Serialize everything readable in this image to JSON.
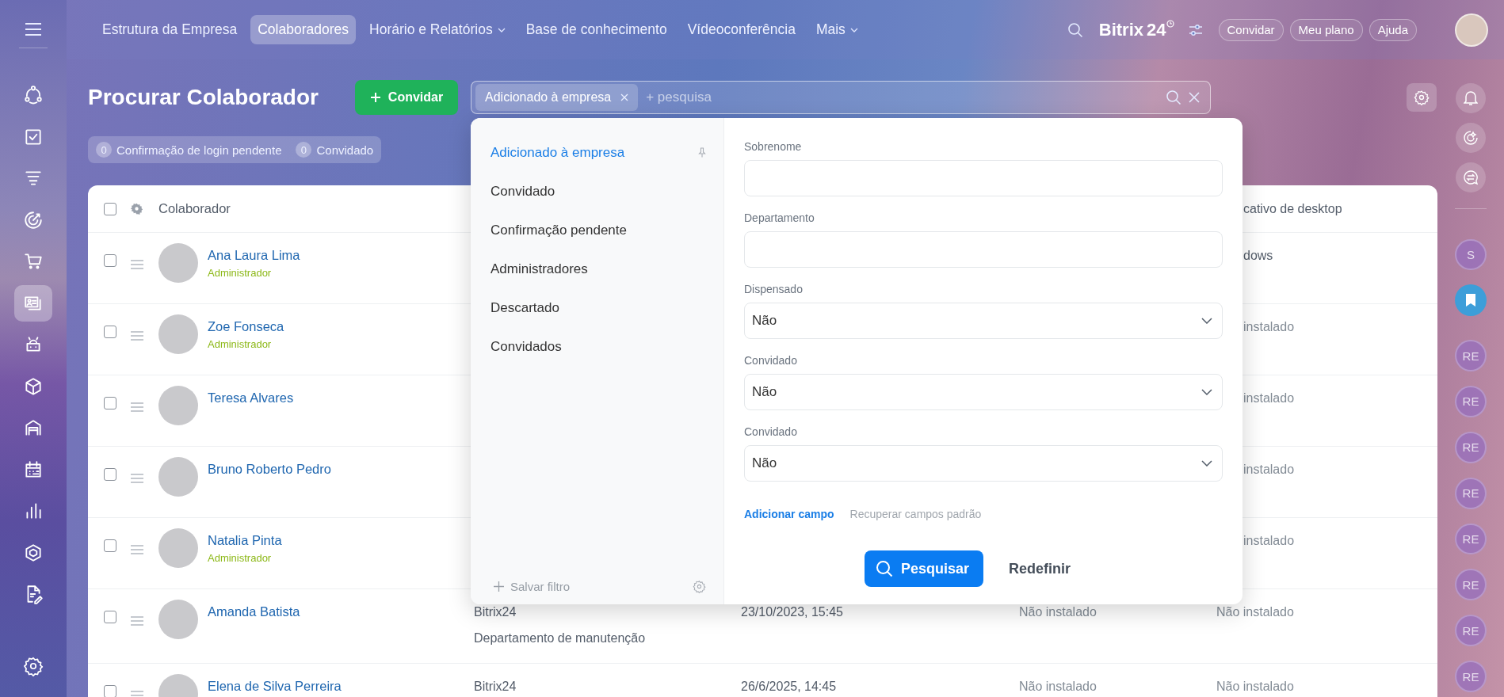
{
  "sidebar": {
    "items": [
      {
        "selected": false
      },
      {
        "selected": false
      },
      {
        "selected": false
      },
      {
        "selected": false
      },
      {
        "selected": false
      },
      {
        "selected": true
      },
      {
        "selected": false
      },
      {
        "selected": false
      },
      {
        "selected": false
      },
      {
        "selected": false
      },
      {
        "selected": false
      },
      {
        "selected": false
      },
      {
        "selected": false
      }
    ]
  },
  "top_nav": {
    "tabs": [
      {
        "label": "Estrutura da Empresa",
        "selected": false,
        "has_menu": false
      },
      {
        "label": "Colaboradores",
        "selected": true,
        "has_menu": false
      },
      {
        "label": "Horário e Relatórios",
        "selected": false,
        "has_menu": true
      },
      {
        "label": "Base de conhecimento",
        "selected": false,
        "has_menu": false
      },
      {
        "label": "Vídeoconferência",
        "selected": false,
        "has_menu": false
      },
      {
        "label": "Mais",
        "selected": false,
        "has_menu": true
      }
    ],
    "logo": {
      "name": "Bitrix",
      "number": "24"
    },
    "buttons": [
      "Convidar",
      "Meu plano",
      "Ajuda"
    ]
  },
  "page": {
    "title": "Procurar Colaborador",
    "invite_button": "Convidar",
    "search": {
      "chips": [
        {
          "label": "Adicionado à empresa"
        }
      ],
      "placeholder": "+ pesquisa"
    },
    "counters": [
      {
        "count": "0",
        "label": "Confirmação de login pendente"
      },
      {
        "count": "0",
        "label": "Convidado"
      }
    ]
  },
  "table": {
    "header_checked": false,
    "columns": [
      {
        "label": "Colaborador"
      },
      {
        "label": "cativo de desktop"
      }
    ],
    "rows": [
      {
        "name": "Ana Laura Lima",
        "role": "Administrador",
        "checked": false,
        "column_5": "dows"
      },
      {
        "name": "Zoe Fonseca",
        "role": "Administrador",
        "checked": false,
        "column_5": "instalado"
      },
      {
        "name": "Teresa Alvares",
        "checked": false,
        "column_5": "instalado"
      },
      {
        "name": "Bruno Roberto Pedro",
        "checked": false,
        "column_5": "instalado"
      },
      {
        "name": "Natalia Pinta",
        "role": "Administrador",
        "checked": false,
        "column_5": "instalado"
      },
      {
        "name": "Amanda Batista",
        "checked": false,
        "column_2": [
          "Bitrix24",
          "Departamento de manutenção"
        ],
        "column_3": "23/10/2023, 15:45",
        "column_4": "Não instalado",
        "column_5": "Não instalado"
      },
      {
        "name": "Elena de Silva Perreira",
        "checked": false,
        "column_2": [
          "Bitrix24"
        ],
        "column_3": "26/6/2025, 14:45",
        "column_4": "Não instalado",
        "column_5": "Não instalado"
      }
    ]
  },
  "filter_popup": {
    "presets": [
      {
        "label": "Adicionado à empresa",
        "selected": true,
        "pinned": true
      },
      {
        "label": "Convidado",
        "selected": false,
        "pinned": false
      },
      {
        "label": "Confirmação pendente",
        "selected": false,
        "pinned": false
      },
      {
        "label": "Administradores",
        "selected": false,
        "pinned": false
      },
      {
        "label": "Descartado",
        "selected": false,
        "pinned": false
      },
      {
        "label": "Convidados",
        "selected": false,
        "pinned": false
      }
    ],
    "save_filter": "Salvar filtro",
    "fields": [
      {
        "kind": "text",
        "label": "Sobrenome"
      },
      {
        "kind": "text",
        "label": "Departamento"
      },
      {
        "kind": "select",
        "label": "Dispensado",
        "value": "Não"
      },
      {
        "kind": "select",
        "label": "Convidado",
        "value": "Não"
      },
      {
        "kind": "select",
        "label": "Convidado",
        "value": "Não"
      }
    ],
    "add_field_link": "Adicionar campo",
    "restore_link": "Recuperar campos padrão",
    "search_button": "Pesquisar",
    "reset_button": "Redefinir"
  },
  "right_rail": {
    "chats": [
      {
        "kind": "initials",
        "text": "S"
      },
      {
        "kind": "bookmark"
      },
      {
        "kind": "initials",
        "text": "RE"
      },
      {
        "kind": "initials",
        "text": "RE"
      },
      {
        "kind": "initials",
        "text": "RE"
      },
      {
        "kind": "initials",
        "text": "RE"
      },
      {
        "kind": "initials",
        "text": "RE"
      },
      {
        "kind": "initials",
        "text": "RE"
      },
      {
        "kind": "initials",
        "text": "RE"
      },
      {
        "kind": "initials",
        "text": "RE"
      }
    ]
  }
}
